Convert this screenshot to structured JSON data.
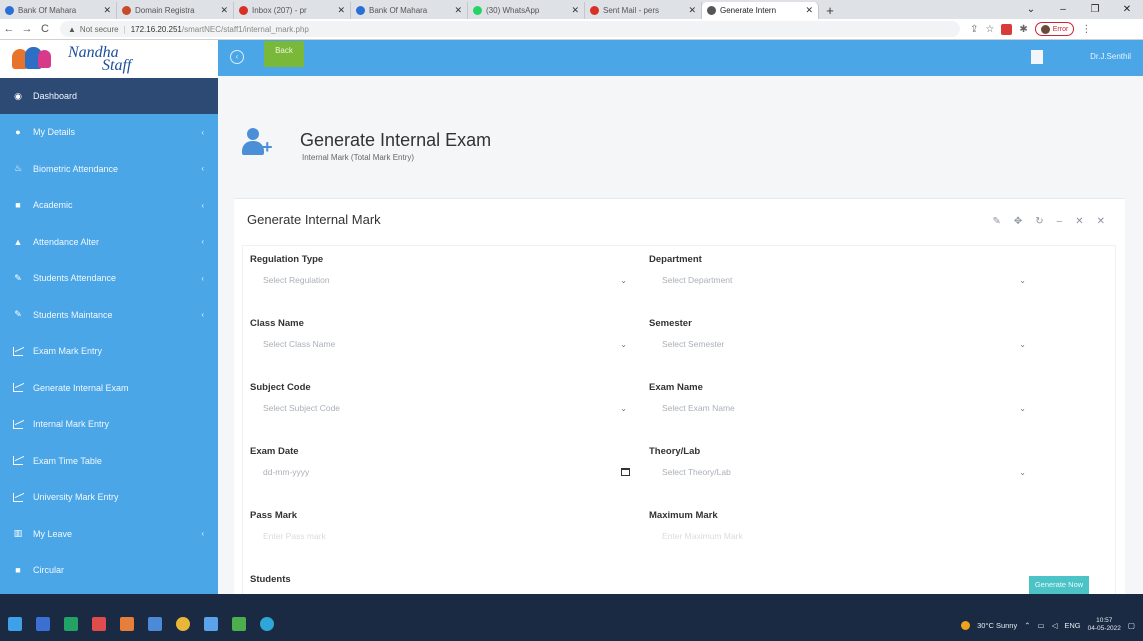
{
  "browser": {
    "tabs": [
      {
        "title": "Bank Of Mahara",
        "favicon_color": "#2b6fd6",
        "active": false
      },
      {
        "title": "Domain Registra",
        "favicon_color": "#c84a2a",
        "active": false
      },
      {
        "title": "Inbox (207) - pr",
        "favicon_color": "#d93025",
        "active": false
      },
      {
        "title": "Bank Of Mahara",
        "favicon_color": "#2b6fd6",
        "active": false
      },
      {
        "title": "(30) WhatsApp",
        "favicon_color": "#25d366",
        "active": false
      },
      {
        "title": "Sent Mail - pers",
        "favicon_color": "#d93025",
        "active": false
      },
      {
        "title": "Generate Intern",
        "favicon_color": "#555555",
        "active": true
      }
    ],
    "warning": "Not secure",
    "url_host": "172.16.20.251",
    "url_path": "/smartNEC/staff1/internal_mark.php",
    "profile_label": "Error"
  },
  "app": {
    "logo_line1": "Nandha",
    "logo_line2": "Staff",
    "back_label": "Back",
    "user_name": "Dr.J.Senthil"
  },
  "sidebar": {
    "items": [
      {
        "label": "Dashboard",
        "icon": "dashboard-icon",
        "glyph": "◉",
        "chevron": false,
        "active": true
      },
      {
        "label": "My Details",
        "icon": "user-icon",
        "glyph": "●",
        "chevron": true,
        "active": false
      },
      {
        "label": "Biometric Attendance",
        "icon": "fingerprint-icon",
        "glyph": "♨",
        "chevron": true,
        "active": false
      },
      {
        "label": "Academic",
        "icon": "book-icon",
        "glyph": "■",
        "chevron": true,
        "active": false
      },
      {
        "label": "Attendance Alter",
        "icon": "car-icon",
        "glyph": "▲",
        "chevron": true,
        "active": false
      },
      {
        "label": "Students Attendance",
        "icon": "pencil-icon",
        "glyph": "✎",
        "chevron": true,
        "active": false
      },
      {
        "label": "Students Maintance",
        "icon": "pencil-icon",
        "glyph": "✎",
        "chevron": true,
        "active": false
      },
      {
        "label": "Exam Mark Entry",
        "icon": "chart-icon",
        "glyph": "",
        "chevron": false,
        "active": false
      },
      {
        "label": "Generate Internal Exam",
        "icon": "chart-icon",
        "glyph": "",
        "chevron": false,
        "active": false
      },
      {
        "label": "Internal Mark Entry",
        "icon": "chart-icon",
        "glyph": "",
        "chevron": false,
        "active": false
      },
      {
        "label": "Exam Time Table",
        "icon": "chart-icon",
        "glyph": "",
        "chevron": false,
        "active": false
      },
      {
        "label": "University Mark Entry",
        "icon": "chart-icon",
        "glyph": "",
        "chevron": false,
        "active": false
      },
      {
        "label": "My Leave",
        "icon": "bar-chart-icon",
        "glyph": "▥",
        "chevron": true,
        "active": false
      },
      {
        "label": "Circular",
        "icon": "doc-icon",
        "glyph": "■",
        "chevron": false,
        "active": false
      }
    ]
  },
  "page": {
    "title": "Generate Internal Exam",
    "subtitle": "Internal Mark (Total Mark Entry)"
  },
  "panel": {
    "title": "Generate Internal Mark",
    "tools": [
      "✎",
      "✥",
      "↻",
      "–",
      "✕",
      "✕"
    ],
    "fields": [
      {
        "label": "Regulation Type",
        "placeholder": "Select Regulation",
        "kind": "select",
        "col": 0,
        "row": 0
      },
      {
        "label": "Department",
        "placeholder": "Select Department",
        "kind": "select",
        "col": 1,
        "row": 0
      },
      {
        "label": "Class Name",
        "placeholder": "Select Class Name",
        "kind": "select",
        "col": 0,
        "row": 1
      },
      {
        "label": "Semester",
        "placeholder": "Select Semester",
        "kind": "select",
        "col": 1,
        "row": 1
      },
      {
        "label": "Subject Code",
        "placeholder": "Select Subject Code",
        "kind": "select",
        "col": 0,
        "row": 2
      },
      {
        "label": "Exam Name",
        "placeholder": "Select Exam Name",
        "kind": "select",
        "col": 1,
        "row": 2
      },
      {
        "label": "Exam Date",
        "placeholder": "dd-mm-yyyy",
        "kind": "date",
        "col": 0,
        "row": 3
      },
      {
        "label": "Theory/Lab",
        "placeholder": "Select Theory/Lab",
        "kind": "select",
        "col": 1,
        "row": 3
      },
      {
        "label": "Pass Mark",
        "placeholder": "Enter Pass mark",
        "kind": "text",
        "col": 0,
        "row": 4
      },
      {
        "label": "Maximum Mark",
        "placeholder": "Enter Maximum Mark",
        "kind": "text",
        "col": 1,
        "row": 4
      },
      {
        "label": "Students",
        "placeholder": "",
        "kind": "label",
        "col": 0,
        "row": 5
      }
    ],
    "submit_label": "Generate Now"
  },
  "taskbar": {
    "apps": [
      {
        "icon": "windows-start-icon",
        "color": "#3fa0ea"
      },
      {
        "icon": "taskview-icon",
        "color": "#3b6fd1"
      },
      {
        "icon": "excel-icon",
        "color": "#21a366"
      },
      {
        "icon": "app-icon",
        "color": "#e04b4b"
      },
      {
        "icon": "photos-icon",
        "color": "#e77e3a"
      },
      {
        "icon": "monitor-icon",
        "color": "#4b8ad6"
      },
      {
        "icon": "chrome-icon",
        "color": "#e9b63a"
      },
      {
        "icon": "files-icon",
        "color": "#5ba2e8"
      },
      {
        "icon": "green-app-icon",
        "color": "#4cae4c"
      },
      {
        "icon": "edge-icon",
        "color": "#2fa6d8"
      }
    ],
    "weather": "30°C  Sunny",
    "lang": "ENG",
    "time": "10:57",
    "date": "04-05-2022"
  }
}
